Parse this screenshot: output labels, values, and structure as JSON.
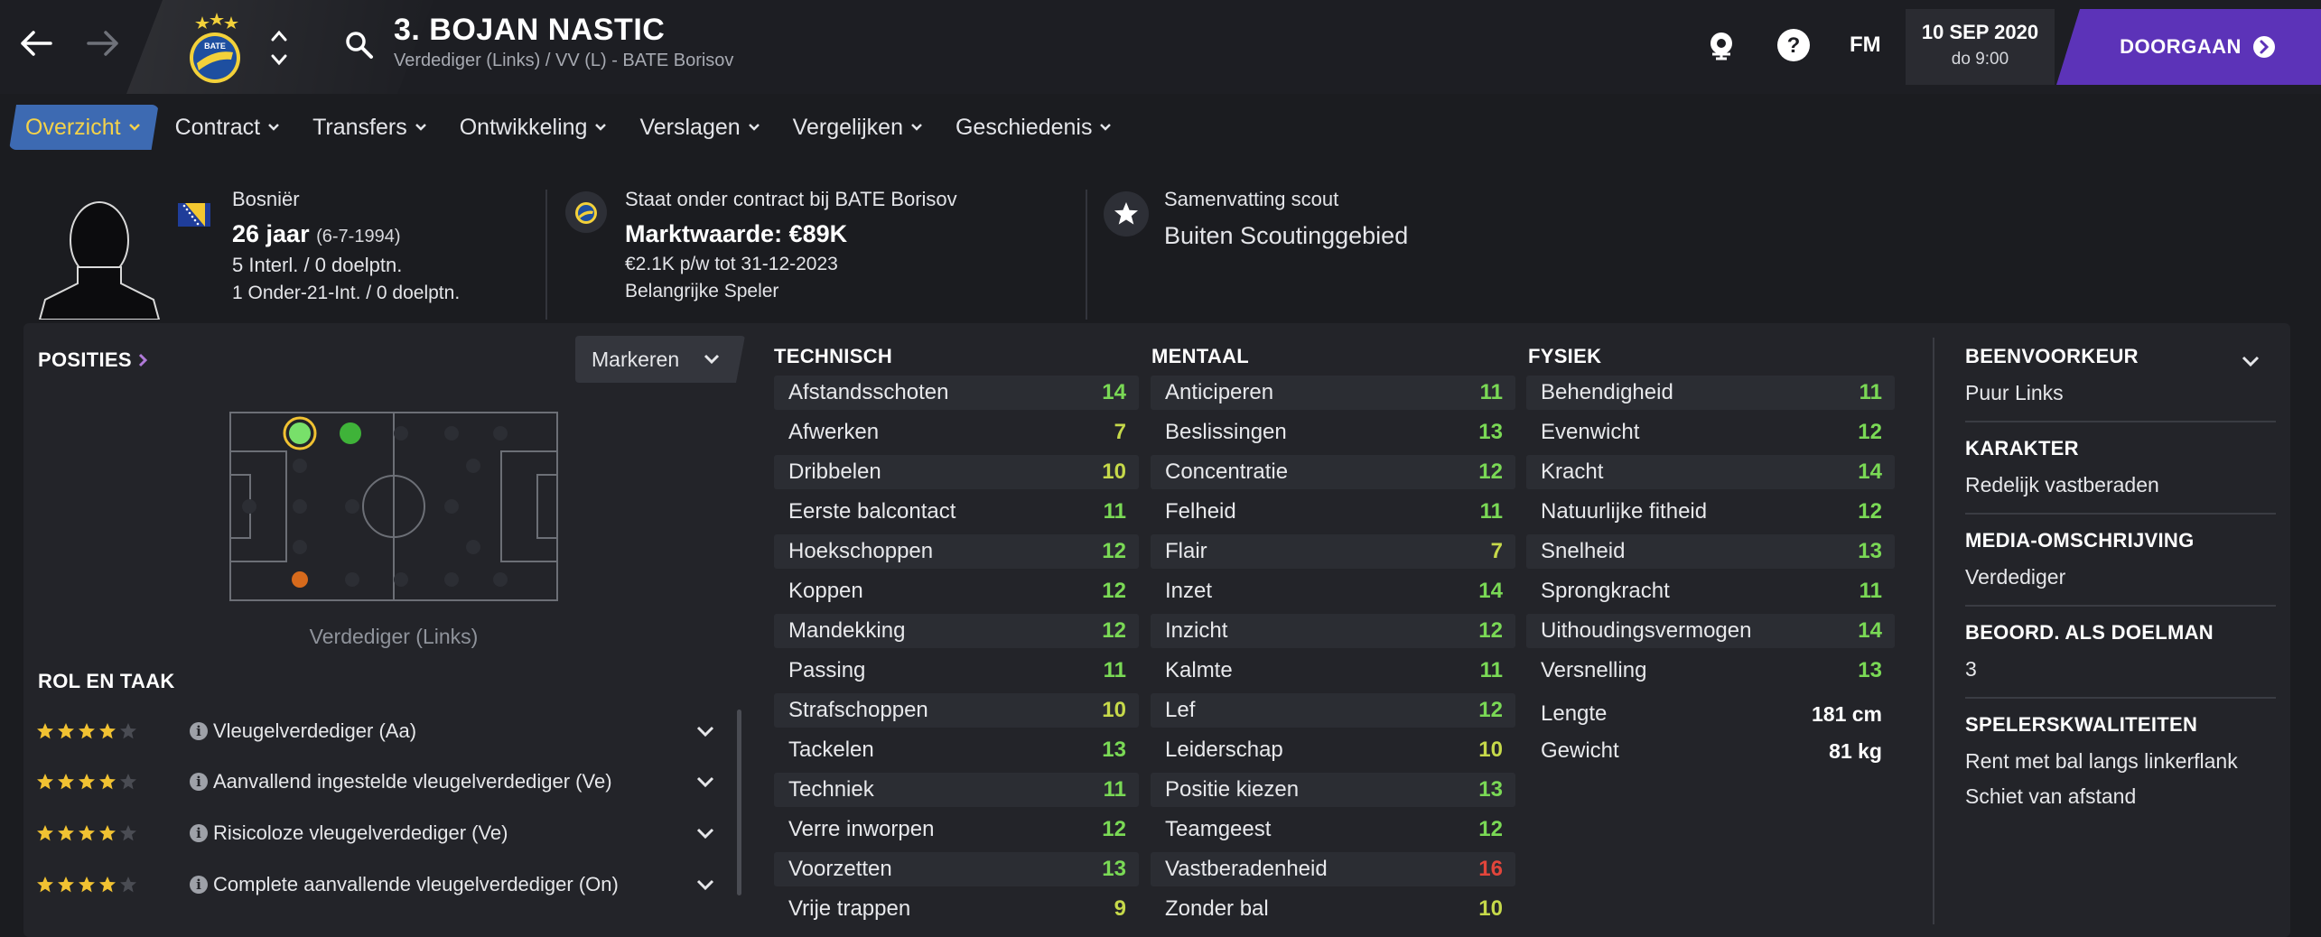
{
  "header": {
    "player_name": "3. BOJAN NASTIC",
    "player_subtitle": "Verdediger (Links) / VV (L) - BATE Borisov",
    "date": "10 SEP 2020",
    "time": "do 9:00",
    "continue_label": "DOORGAAN",
    "fm_label": "FM"
  },
  "tabs": [
    {
      "label": "Overzicht",
      "active": true
    },
    {
      "label": "Contract"
    },
    {
      "label": "Transfers"
    },
    {
      "label": "Ontwikkeling"
    },
    {
      "label": "Verslagen"
    },
    {
      "label": "Vergelijken"
    },
    {
      "label": "Geschiedenis"
    }
  ],
  "info": {
    "nationality": "Bosniër",
    "age": "26 jaar",
    "birthdate": "(6-7-1994)",
    "caps": "5 Interl. / 0 doelptn.",
    "u21_caps": "1 Onder-21-Int. / 0 doelptn.",
    "contract_club": "Staat onder contract bij BATE Borisov",
    "market_value": "Marktwaarde: €89K",
    "wage": "€2.1K p/w tot 31-12-2023",
    "squad_status": "Belangrijke Speler",
    "scout_title": "Samenvatting scout",
    "scout_value": "Buiten Scoutinggebied"
  },
  "positions": {
    "title": "POSITIES",
    "markeren_label": "Markeren",
    "caption": "Verdediger (Links)"
  },
  "roles": {
    "title": "ROL EN TAAK",
    "items": [
      {
        "label": "Vleugelverdediger (Aa)",
        "stars": 4
      },
      {
        "label": "Aanvallend ingestelde vleugelverdediger (Ve)",
        "stars": 4
      },
      {
        "label": "Risicoloze vleugelverdediger (Ve)",
        "stars": 4
      },
      {
        "label": "Complete aanvallende vleugelverdediger (On)",
        "stars": 4
      }
    ]
  },
  "technical": {
    "title": "TECHNISCH",
    "attributes": [
      {
        "name": "Afstandsschoten",
        "value": "14",
        "c": "g"
      },
      {
        "name": "Afwerken",
        "value": "7",
        "c": "y"
      },
      {
        "name": "Dribbelen",
        "value": "10",
        "c": "y"
      },
      {
        "name": "Eerste balcontact",
        "value": "11",
        "c": "g"
      },
      {
        "name": "Hoekschoppen",
        "value": "12",
        "c": "g"
      },
      {
        "name": "Koppen",
        "value": "12",
        "c": "g"
      },
      {
        "name": "Mandekking",
        "value": "12",
        "c": "g"
      },
      {
        "name": "Passing",
        "value": "11",
        "c": "g"
      },
      {
        "name": "Strafschoppen",
        "value": "10",
        "c": "y"
      },
      {
        "name": "Tackelen",
        "value": "13",
        "c": "g"
      },
      {
        "name": "Techniek",
        "value": "11",
        "c": "g"
      },
      {
        "name": "Verre inworpen",
        "value": "12",
        "c": "g"
      },
      {
        "name": "Voorzetten",
        "value": "13",
        "c": "g"
      },
      {
        "name": "Vrije trappen",
        "value": "9",
        "c": "y"
      }
    ]
  },
  "mental": {
    "title": "MENTAAL",
    "attributes": [
      {
        "name": "Anticiperen",
        "value": "11",
        "c": "g"
      },
      {
        "name": "Beslissingen",
        "value": "13",
        "c": "g"
      },
      {
        "name": "Concentratie",
        "value": "12",
        "c": "g"
      },
      {
        "name": "Felheid",
        "value": "11",
        "c": "g"
      },
      {
        "name": "Flair",
        "value": "7",
        "c": "y"
      },
      {
        "name": "Inzet",
        "value": "14",
        "c": "g"
      },
      {
        "name": "Inzicht",
        "value": "12",
        "c": "g"
      },
      {
        "name": "Kalmte",
        "value": "11",
        "c": "g"
      },
      {
        "name": "Lef",
        "value": "12",
        "c": "g"
      },
      {
        "name": "Leiderschap",
        "value": "10",
        "c": "y"
      },
      {
        "name": "Positie kiezen",
        "value": "13",
        "c": "g"
      },
      {
        "name": "Teamgeest",
        "value": "12",
        "c": "g"
      },
      {
        "name": "Vastberadenheid",
        "value": "16",
        "c": "r"
      },
      {
        "name": "Zonder bal",
        "value": "10",
        "c": "y"
      }
    ]
  },
  "physical": {
    "title": "FYSIEK",
    "attributes": [
      {
        "name": "Behendigheid",
        "value": "11",
        "c": "g"
      },
      {
        "name": "Evenwicht",
        "value": "12",
        "c": "g"
      },
      {
        "name": "Kracht",
        "value": "14",
        "c": "g"
      },
      {
        "name": "Natuurlijke fitheid",
        "value": "12",
        "c": "g"
      },
      {
        "name": "Snelheid",
        "value": "13",
        "c": "g"
      },
      {
        "name": "Sprongkracht",
        "value": "11",
        "c": "g"
      },
      {
        "name": "Uithoudingsvermogen",
        "value": "14",
        "c": "g"
      },
      {
        "name": "Versnelling",
        "value": "13",
        "c": "g"
      }
    ],
    "length_label": "Lengte",
    "length_value": "181 cm",
    "weight_label": "Gewicht",
    "weight_value": "81 kg"
  },
  "sidebar": {
    "foot_title": "BEENVOORKEUR",
    "foot_value": "Puur Links",
    "character_title": "KARAKTER",
    "character_value": "Redelijk vastberaden",
    "media_title": "MEDIA-OMSCHRIJVING",
    "media_value": "Verdediger",
    "gk_title": "BEOORD. ALS DOELMAN",
    "gk_value": "3",
    "qualities_title": "SPELERSKWALITEITEN",
    "qualities": [
      "Rent met bal langs linkerflank",
      "Schiet van afstand"
    ]
  },
  "colors": {
    "accent_purple": "#5c33b8",
    "tab_active_bg": "#3d6ab2",
    "tab_active_text": "#f4d24a",
    "attr_green": "#7ad955",
    "attr_yellow": "#c6d94a",
    "attr_red": "#e2453b"
  }
}
